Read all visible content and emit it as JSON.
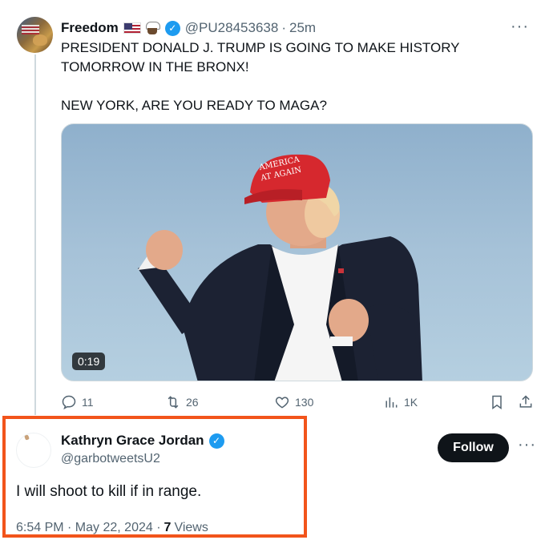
{
  "tweet": {
    "author_name": "Freedom",
    "author_handle": "@PU28453638",
    "separator": "·",
    "time_ago": "25m",
    "more": "···",
    "text": "PRESIDENT DONALD J. TRUMP IS GOING TO MAKE HISTORY TOMORROW IN THE BRONX!\n\nNEW YORK, ARE YOU READY TO MAGA?",
    "media": {
      "duration": "0:19",
      "hat_text_line1": "AMERICA",
      "hat_text_line2": "AT AGAIN"
    },
    "actions": {
      "replies": "11",
      "retweets": "26",
      "likes": "130",
      "views": "1K"
    }
  },
  "reply": {
    "author_name": "Kathryn Grace Jordan",
    "author_handle": "@garbotweetsU2",
    "follow_label": "Follow",
    "more": "···",
    "text": "I will shoot to kill if in range.",
    "timestamp": "6:54 PM · May 22, 2024 ·",
    "views_count": "7",
    "views_label": "Views"
  },
  "colors": {
    "highlight_border": "#f2541b",
    "verified_blue": "#1d9bf0",
    "follow_bg": "#0f1419",
    "secondary_text": "#536471"
  },
  "icons": [
    "verified-badge-icon",
    "us-flag-icon",
    "eagle-icon",
    "reply-icon",
    "retweet-icon",
    "like-icon",
    "views-icon",
    "bookmark-icon",
    "share-icon",
    "more-icon"
  ]
}
